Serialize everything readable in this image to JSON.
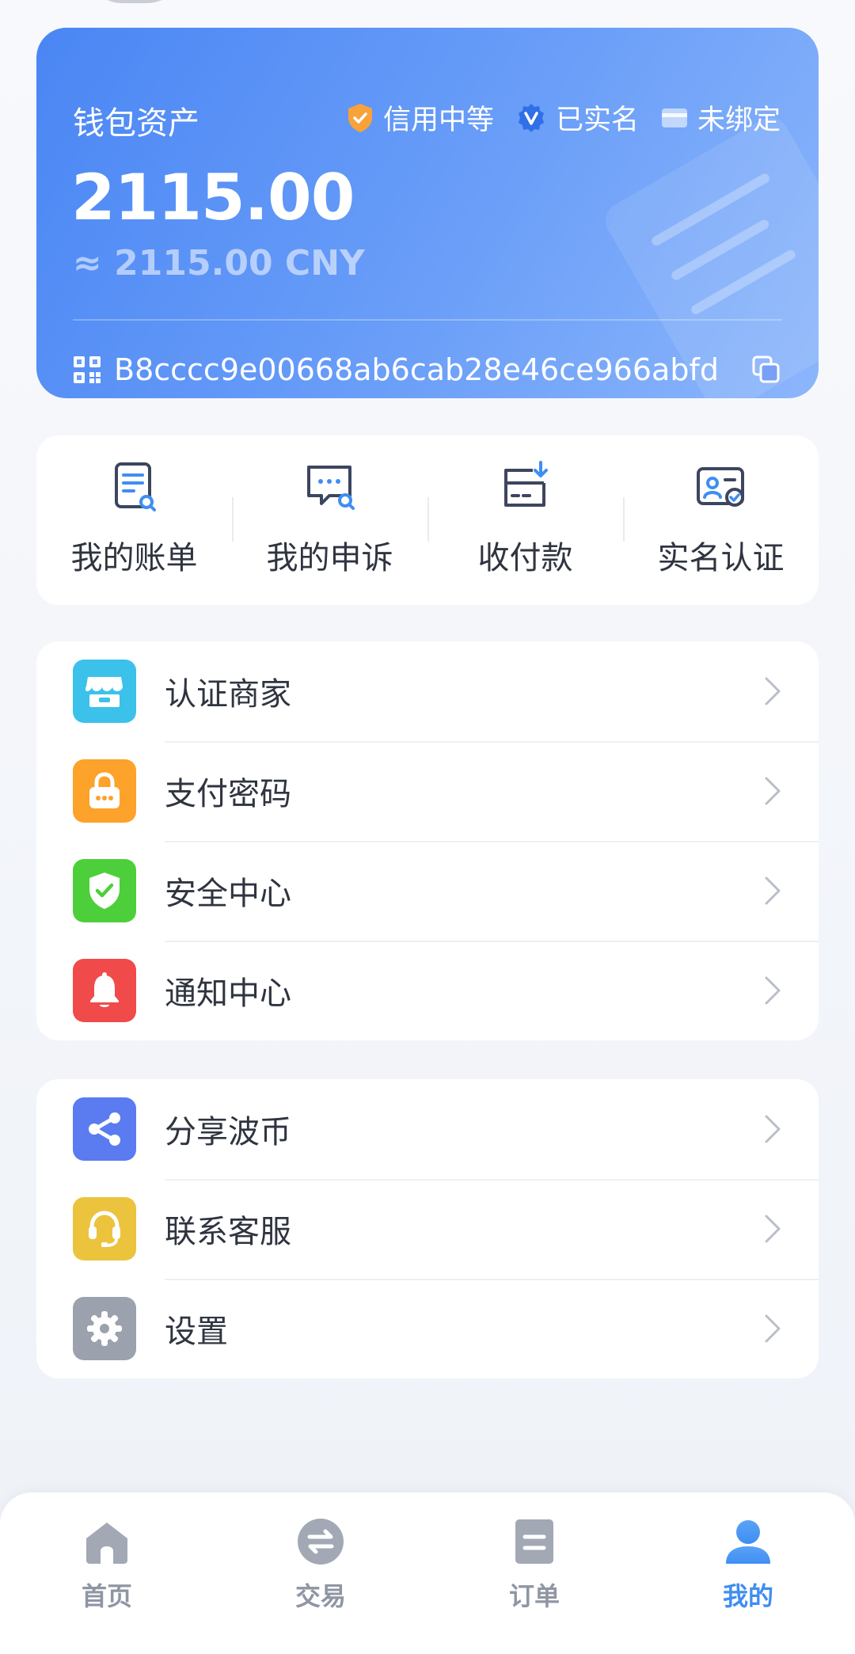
{
  "wallet": {
    "title": "钱包资产",
    "badges": {
      "credit": "信用中等",
      "verified": "已实名",
      "card": "未绑定"
    },
    "balance": "2115.00",
    "balance_cny": "≈ 2115.00 CNY",
    "address": "B8cccc9e00668ab6cab28e46ce966abfd",
    "icons": {
      "credit": "shield-icon",
      "verified": "verified-v-icon",
      "card": "bank-card-icon",
      "address": "qrcode-icon",
      "copy": "copy-icon"
    }
  },
  "quick_actions": [
    {
      "label": "我的账单",
      "icon": "bill-search-icon"
    },
    {
      "label": "我的申诉",
      "icon": "chat-search-icon"
    },
    {
      "label": "收付款",
      "icon": "receive-pay-icon"
    },
    {
      "label": "实名认证",
      "icon": "id-card-check-icon"
    }
  ],
  "menu_group_1": [
    {
      "label": "认证商家",
      "icon": "store-icon",
      "color": "#3cc1ea"
    },
    {
      "label": "支付密码",
      "icon": "lock-icon",
      "color": "#fda22a"
    },
    {
      "label": "安全中心",
      "icon": "shield-check-icon",
      "color": "#4ccf3a"
    },
    {
      "label": "通知中心",
      "icon": "bell-icon",
      "color": "#f04a4a"
    }
  ],
  "menu_group_2": [
    {
      "label": "分享波币",
      "icon": "share-icon",
      "color": "#5a7cf0"
    },
    {
      "label": "联系客服",
      "icon": "headset-icon",
      "color": "#ebc33d"
    },
    {
      "label": "设置",
      "icon": "gear-icon",
      "color": "#9ca1ae"
    }
  ],
  "tabbar": {
    "active_color": "#3f8ef2",
    "inactive_color": "#8f96a3",
    "tabs": [
      {
        "label": "首页",
        "icon": "home-icon"
      },
      {
        "label": "交易",
        "icon": "exchange-icon"
      },
      {
        "label": "订单",
        "icon": "order-icon"
      },
      {
        "label": "我的",
        "icon": "user-icon",
        "active": true
      }
    ]
  }
}
